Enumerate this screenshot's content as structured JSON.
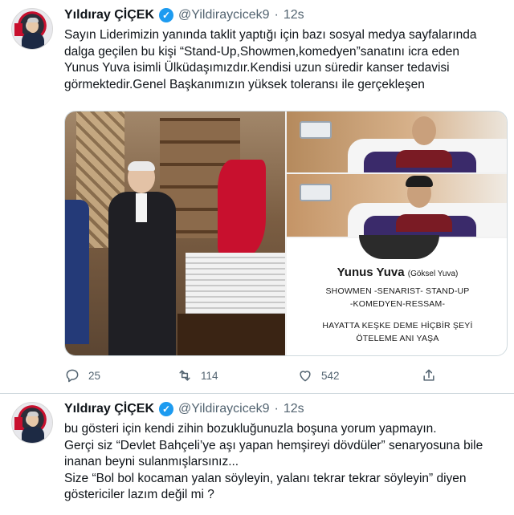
{
  "tweets": [
    {
      "name": "Yıldıray ÇİÇEK",
      "verified_glyph": "✓",
      "handle": "@Yildiraycicek9",
      "dot": "·",
      "time": "12s",
      "lines": [
        "Sayın Liderimizin yanında taklit yaptığı için bazı sosyal medya sayfalarında",
        "dalga geçilen bu kişi “Stand-Up,Showmen,komedyen”sanatını icra eden",
        "Yunus Yuva isimli Ülküdaşımızdır.Kendisi uzun süredir kanser tedavisi",
        "görmektedir.Genel Başkanımızın yüksek toleransı ile gerçekleşen"
      ],
      "media": {
        "card_name": "Yunus Yuva",
        "card_name_small": "(Göksel Yuva)",
        "card_lines": [
          "SHOWMEN -SENARIST- STAND-UP",
          "-KOMEDYEN-RESSAM-",
          "HAYATTA KEŞKE DEME HİÇBİR ŞEYİ",
          "ÖTELEME ANI YAŞA"
        ]
      },
      "stats": {
        "replies": "25",
        "retweets": "114",
        "likes": "542"
      }
    },
    {
      "name": "Yıldıray ÇİÇEK",
      "verified_glyph": "✓",
      "handle": "@Yildiraycicek9",
      "dot": "·",
      "time": "12s",
      "lines": [
        "bu gösteri için kendi zihin bozukluğunuzla boşuna yorum yapmayın.",
        "Gerçi siz “Devlet Bahçeli’ye aşı yapan hemşireyi dövdüler” senaryosuna bile",
        "inanan beyni sulanmışlarsınız...",
        "Size “Bol bol kocaman yalan söyleyin, yalanı tekrar tekrar söyleyin” diyen",
        "göstericiler lazım değil mi ?"
      ]
    }
  ],
  "icons": {
    "reply": "reply-icon",
    "retweet": "retweet-icon",
    "like": "heart-icon",
    "share": "share-icon",
    "verified": "verified-badge-icon"
  },
  "colors": {
    "accent": "#1d9bf0",
    "muted": "#536471",
    "text": "#0f1419",
    "border": "#cfd9de"
  }
}
